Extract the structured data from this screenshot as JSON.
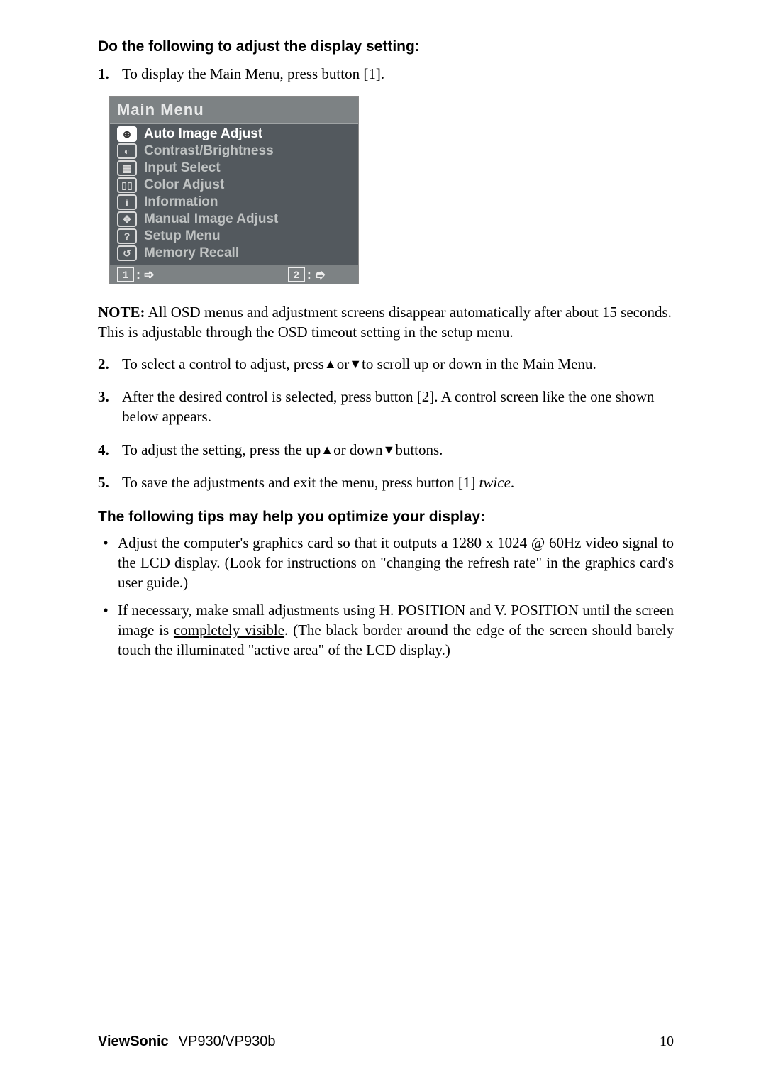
{
  "heading1": "Do the following to adjust the display setting:",
  "step1": {
    "num": "1.",
    "text": "To display the Main Menu, press button [1]."
  },
  "osd": {
    "title": "Main Menu",
    "items": [
      {
        "icon": "⊕",
        "label": "Auto Image Adjust",
        "selected": true
      },
      {
        "icon": "◐",
        "label": "Contrast/Brightness",
        "selected": false
      },
      {
        "icon": "▦",
        "label": "Input Select",
        "selected": false
      },
      {
        "icon": "▯▯",
        "label": "Color Adjust",
        "selected": false
      },
      {
        "icon": "i",
        "label": "Information",
        "selected": false
      },
      {
        "icon": "✥",
        "label": "Manual Image Adjust",
        "selected": false
      },
      {
        "icon": "?",
        "label": "Setup Menu",
        "selected": false
      },
      {
        "icon": "↺",
        "label": "Memory Recall",
        "selected": false
      }
    ],
    "footer": {
      "left_key": "1",
      "left_sym": ": ➩",
      "right_key": "2",
      "right_sym": ": ➮"
    }
  },
  "note_label": "NOTE:",
  "note_text": " All OSD menus and adjustment screens disappear automatically after about 15 seconds. This is adjustable through the OSD timeout setting in the setup menu.",
  "step2": {
    "num": "2.",
    "pre": "To select a control to adjust, press",
    "mid": "or",
    "post": "to scroll up or down in the Main Menu."
  },
  "step3": {
    "num": "3.",
    "text": "After the desired control is selected, press button [2]. A control screen like the one shown below appears."
  },
  "step4": {
    "num": "4.",
    "pre": "To adjust the setting, press the up",
    "mid": "or down",
    "post": "buttons."
  },
  "step5": {
    "num": "5.",
    "pre": "To save the adjustments and exit the menu, press button [1] ",
    "em": "twice",
    "post": "."
  },
  "heading2": "The following tips may help you optimize your display:",
  "tip1": "Adjust the computer's graphics card so that it outputs a 1280 x 1024 @ 60Hz  video signal to the LCD display. (Look for instructions on \"changing the refresh rate\" in the graphics card's user guide.)",
  "tip2_pre": "If necessary, make small adjustments using H. POSITION and V. POSITION until the screen image is ",
  "tip2_ul": "completely visible",
  "tip2_post": ". (The black border around the edge of the screen should barely touch the illuminated \"active area\" of the LCD display.)",
  "footer": {
    "brand": "ViewSonic",
    "model": "VP930/VP930b",
    "page": "10"
  },
  "arrows": {
    "up": "▲",
    "down": "▼"
  }
}
